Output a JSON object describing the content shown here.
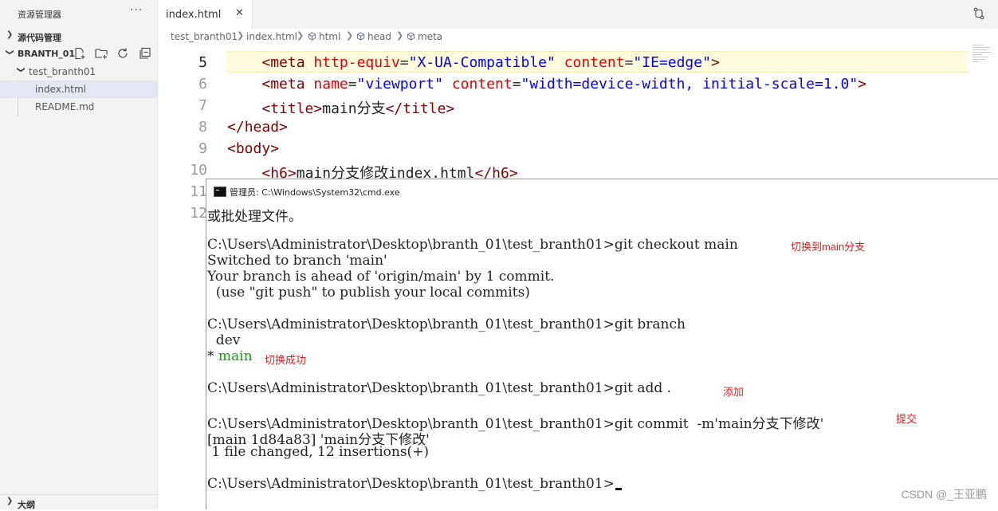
{
  "sidebar": {
    "title": "资源管理器",
    "more": "···",
    "source_control": "源代码管理",
    "workspace": "BRANTH_01",
    "folder": "test_branth01",
    "files": [
      "index.html",
      "README.md"
    ],
    "outline": "大纲"
  },
  "tabs": [
    {
      "label": "index.html",
      "close": "✕"
    }
  ],
  "breadcrumb": [
    "test_branth01",
    "index.html",
    "html",
    "head",
    "meta"
  ],
  "editor": {
    "lines": [
      {
        "n": "5",
        "active": true
      },
      {
        "n": "6"
      },
      {
        "n": "7"
      },
      {
        "n": "8"
      },
      {
        "n": "9"
      },
      {
        "n": "10"
      },
      {
        "n": "11"
      },
      {
        "n": "12"
      }
    ],
    "code": {
      "l5_tag": "meta",
      "l5_a1": "http-equiv",
      "l5_v1": "\"X-UA-Compatible\"",
      "l5_a2": "content",
      "l5_v2": "\"IE=edge\"",
      "l6_tag": "meta",
      "l6_a1": "name",
      "l6_v1": "\"viewport\"",
      "l6_a2": "content",
      "l6_v2": "\"width=device-width, initial-scale=1.0\"",
      "l7_tag": "title",
      "l7_text": "main分支",
      "l8_tag": "head",
      "l9_tag": "body",
      "l10_tag": "h6",
      "l10_text": "main分支修改index.html"
    }
  },
  "cmd": {
    "title": "管理员: C:\\Windows\\System32\\cmd.exe",
    "lines": [
      "或批处理文件。",
      "",
      "C:\\Users\\Administrator\\Desktop\\branth_01\\test_branth01>git checkout main",
      "Switched to branch 'main'",
      "Your branch is ahead of 'origin/main' by 1 commit.",
      "  (use \"git push\" to publish your local commits)",
      "",
      "C:\\Users\\Administrator\\Desktop\\branth_01\\test_branth01>git branch",
      "  dev",
      "* main",
      "",
      "C:\\Users\\Administrator\\Desktop\\branth_01\\test_branth01>git add .",
      "",
      "C:\\Users\\Administrator\\Desktop\\branth_01\\test_branth01>git commit  -m'main分支下修改'",
      "[main 1d84a83] 'main分支下修改'",
      " 1 file changed, 12 insertions(+)",
      "",
      "C:\\Users\\Administrator\\Desktop\\branth_01\\test_branth01>"
    ],
    "notes": {
      "checkout": "切换到main分支",
      "success": "切换成功",
      "add": "添加",
      "commit": "提交"
    },
    "star": "*",
    "main_branch": "main"
  },
  "watermark": "CSDN @_王亚鹏",
  "colors": {
    "note": "#e02020",
    "branch_green": "#13a10e",
    "current_line": "#fffbdd"
  }
}
